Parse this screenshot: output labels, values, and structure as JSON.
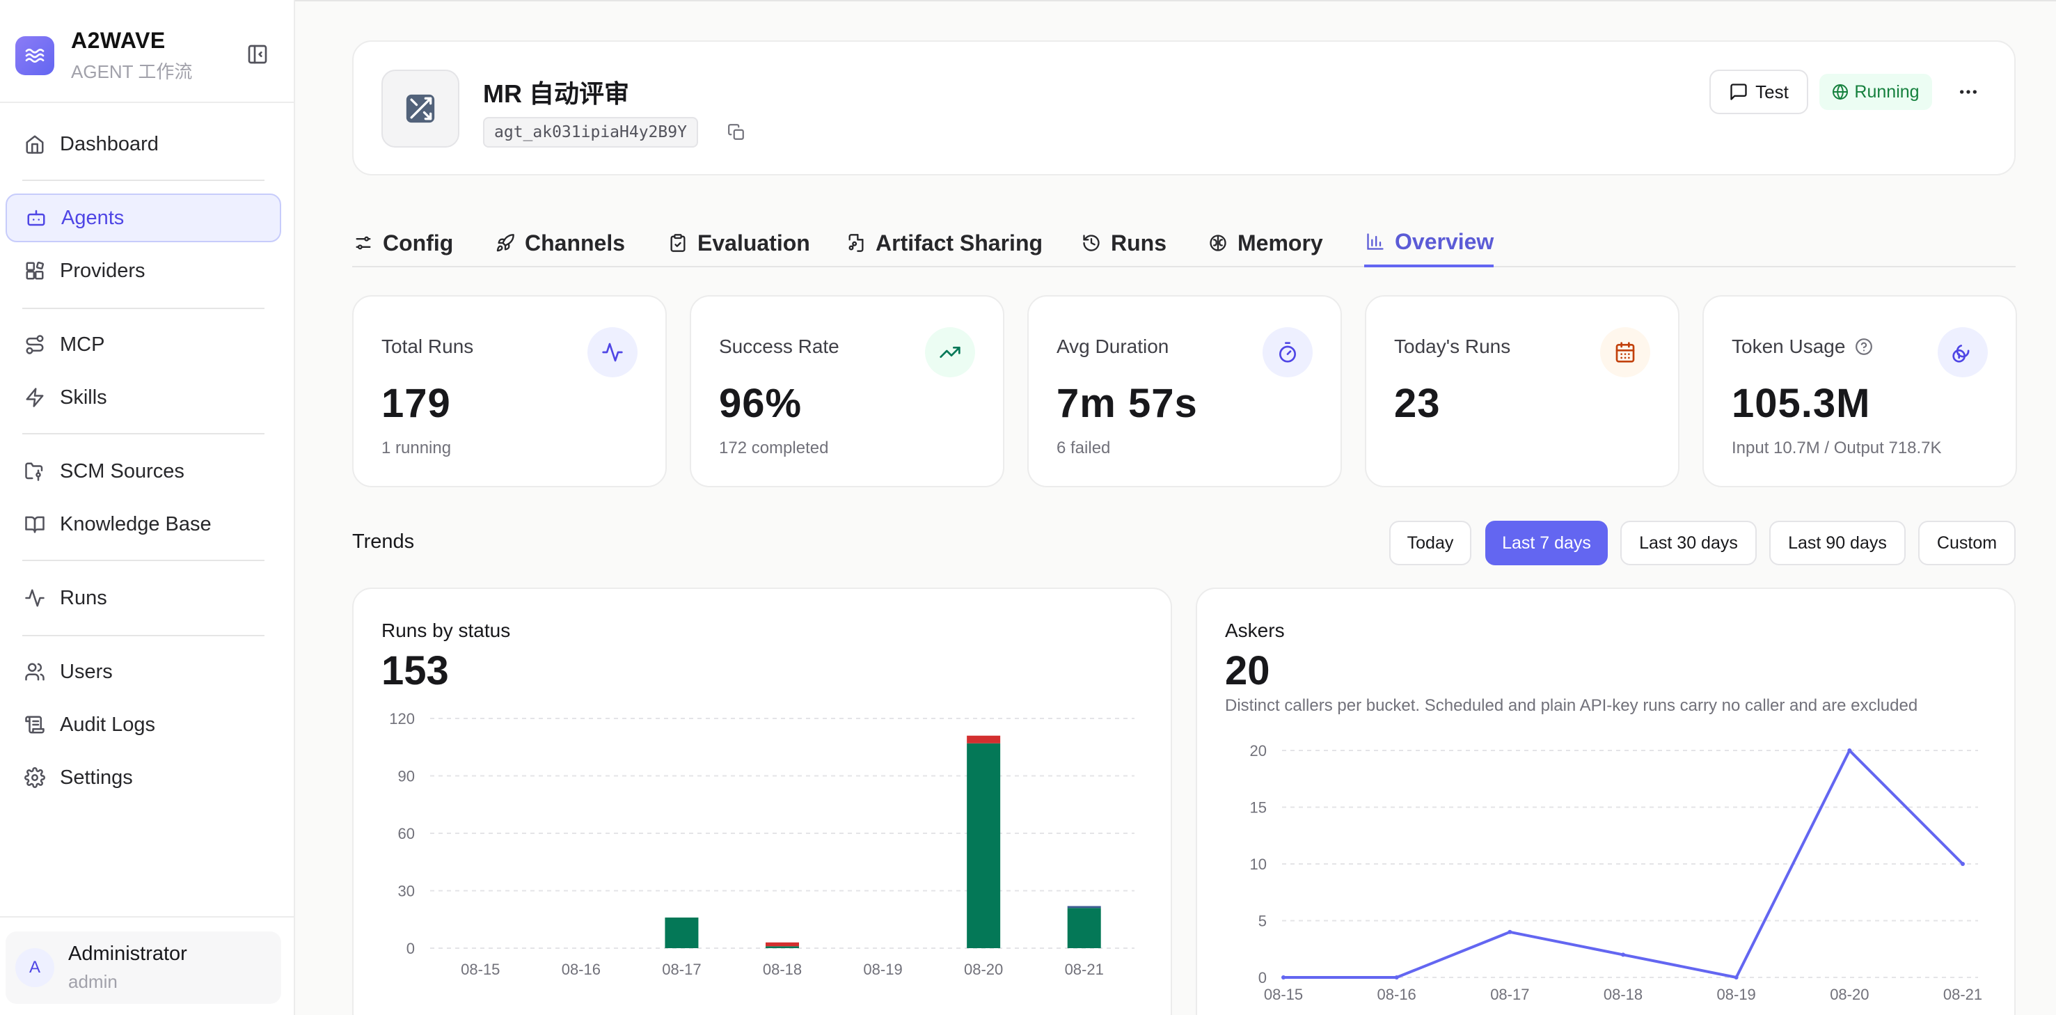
{
  "app": {
    "brand_name": "A2WAVE",
    "brand_sub": "AGENT 工作流"
  },
  "sidebar": {
    "items": [
      {
        "label": "Dashboard",
        "icon": "home-icon"
      },
      {
        "label": "Agents",
        "icon": "bot-icon",
        "active": true
      },
      {
        "label": "Providers",
        "icon": "blocks-icon"
      },
      {
        "label": "MCP",
        "icon": "route-icon"
      },
      {
        "label": "Skills",
        "icon": "zap-icon"
      },
      {
        "label": "SCM Sources",
        "icon": "folder-git-icon"
      },
      {
        "label": "Knowledge Base",
        "icon": "book-open-icon"
      },
      {
        "label": "Runs",
        "icon": "activity-icon"
      },
      {
        "label": "Users",
        "icon": "users-icon"
      },
      {
        "label": "Audit Logs",
        "icon": "scroll-icon"
      },
      {
        "label": "Settings",
        "icon": "gear-icon"
      }
    ]
  },
  "user": {
    "initial": "A",
    "name": "Administrator",
    "role": "admin"
  },
  "agent": {
    "title": "MR 自动评审",
    "id": "agt_ak031ipiaH4y2B9Y",
    "test_label": "Test",
    "status": "Running"
  },
  "tabs": [
    {
      "label": "Config",
      "icon": "sliders-icon"
    },
    {
      "label": "Channels",
      "icon": "rocket-icon"
    },
    {
      "label": "Evaluation",
      "icon": "clipboard-check-icon"
    },
    {
      "label": "Artifact Sharing",
      "icon": "file-share-icon"
    },
    {
      "label": "Runs",
      "icon": "history-icon"
    },
    {
      "label": "Memory",
      "icon": "brain-icon"
    },
    {
      "label": "Overview",
      "icon": "bar-chart-icon",
      "active": true
    }
  ],
  "stats": [
    {
      "label": "Total Runs",
      "value": "179",
      "sub": "1 running",
      "icon": "activity-icon",
      "color": "#4f46e5"
    },
    {
      "label": "Success Rate",
      "value": "96%",
      "sub": "172 completed",
      "icon": "trending-up-icon",
      "color": "#047857"
    },
    {
      "label": "Avg Duration",
      "value": "7m 57s",
      "sub": "6 failed",
      "icon": "timer-icon",
      "color": "#4f46e5"
    },
    {
      "label": "Today's Runs",
      "value": "23",
      "sub": "",
      "icon": "calendar-icon",
      "color": "#c2410c"
    },
    {
      "label": "Token Usage",
      "value": "105.3M",
      "sub": "Input 10.7M / Output 718.7K",
      "icon": "coins-icon",
      "color": "#4f46e5"
    }
  ],
  "trends": {
    "title": "Trends",
    "ranges": [
      {
        "label": "Today"
      },
      {
        "label": "Last 7 days",
        "active": true
      },
      {
        "label": "Last 30 days"
      },
      {
        "label": "Last 90 days"
      },
      {
        "label": "Custom"
      }
    ]
  },
  "charts": {
    "runs": {
      "title": "Runs by status",
      "total": "153"
    },
    "askers": {
      "title": "Askers",
      "total": "20",
      "description": "Distinct callers per bucket. Scheduled and plain API-key runs carry no caller and are excluded"
    }
  },
  "chart_data": [
    {
      "type": "bar",
      "stacked": true,
      "title": "Runs by status",
      "categories": [
        "08-15",
        "08-16",
        "08-17",
        "08-18",
        "08-19",
        "08-20",
        "08-21"
      ],
      "series": [
        {
          "values": [
            0,
            0,
            16,
            1,
            0,
            107,
            21
          ],
          "color": "#047857"
        },
        {
          "values": [
            0,
            0,
            0,
            2,
            0,
            4,
            0
          ],
          "color": "#d32f2f"
        },
        {
          "values": [
            0,
            0,
            0,
            0,
            0,
            0,
            1
          ],
          "color": "#3b5b92"
        }
      ],
      "ylim": [
        0,
        120
      ],
      "yticks": [
        0,
        30,
        60,
        90,
        120
      ],
      "grid": true
    },
    {
      "type": "line",
      "title": "Askers",
      "categories": [
        "08-15",
        "08-16",
        "08-17",
        "08-18",
        "08-19",
        "08-20",
        "08-21"
      ],
      "values": [
        0,
        0,
        4,
        2,
        0,
        20,
        10
      ],
      "color": "#6366f1",
      "ylim": [
        0,
        20
      ],
      "yticks": [
        0,
        5,
        10,
        15,
        20
      ],
      "grid": true
    }
  ]
}
